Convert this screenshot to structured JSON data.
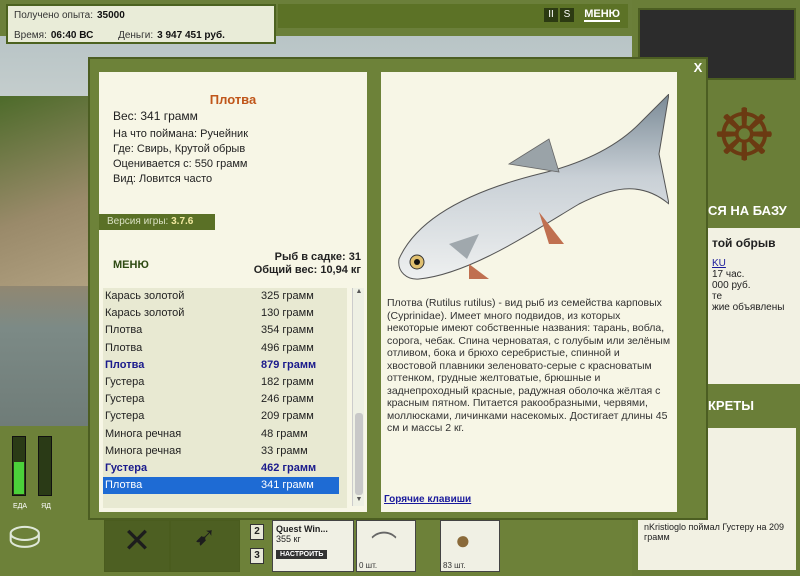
{
  "hud": {
    "experience_label": "Получено опыта:",
    "experience_value": "35000",
    "time_label": "Время:",
    "time_value": "06:40 ВС",
    "money_label": "Деньги:",
    "money_value": "3 947 451 руб."
  },
  "topbar": {
    "pause": "II",
    "sound": "S",
    "menu": "МЕНЮ"
  },
  "modal": {
    "close": "X",
    "fish_name": "Плотва",
    "weight": "Вес: 341 грамм",
    "caught_with": "На что поймана: Ручейник",
    "where": "Где: Свирь, Крутой обрыв",
    "valued_from": "Оценивается с: 550 грамм",
    "kind": "Вид: Ловится часто",
    "version_label": "Версия игры:",
    "version_value": "3.7.6",
    "menu_link": "МЕНЮ",
    "keepnet_count": "Рыб в садке: 31",
    "keepnet_weight": "Общий вес: 10,94 кг",
    "catch_list": [
      {
        "name": "Карась золотой",
        "weight": "325 грамм",
        "style": ""
      },
      {
        "name": "Карась золотой",
        "weight": "130 грамм",
        "style": ""
      },
      {
        "name": "Плотва",
        "weight": "354 грамм",
        "style": ""
      },
      {
        "name": "Плотва",
        "weight": "496 грамм",
        "style": ""
      },
      {
        "name": "Плотва",
        "weight": "879 грамм",
        "style": "bold"
      },
      {
        "name": "Густера",
        "weight": "182 грамм",
        "style": ""
      },
      {
        "name": "Густера",
        "weight": "246 грамм",
        "style": ""
      },
      {
        "name": "Густера",
        "weight": "209 грамм",
        "style": ""
      },
      {
        "name": "Минога речная",
        "weight": "48 грамм",
        "style": ""
      },
      {
        "name": "Минога речная",
        "weight": "33 грамм",
        "style": ""
      },
      {
        "name": "Густера",
        "weight": "462 грамм",
        "style": "bold"
      },
      {
        "name": "Плотва",
        "weight": "341 грамм",
        "style": "sel"
      }
    ],
    "description": "Плотва (Rutilus rutilus) - вид рыб из семейства карповых (Cyprinidae). Имеет много подвидов, из которых некоторые имеют собственные названия: тарань, вобла, сорога, чебак. Спина черноватая, с голубым или зелёным отливом, бока и брюхо серебристые, спинной и хвостовой плавники зеленовато-серые с красноватым оттенком, грудные желтоватые, брюшные и заднепроходный красные, радужная оболочка жёлтая с красным пятном. Питается ракообразными, червями, моллюсками, личинками насекомых. Достигает длины 45 см и массы 2 кг.",
    "hotkeys_link": "Горячие клавиши"
  },
  "right_panel": {
    "base_label": "СЯ НА БАЗУ",
    "location": "той обрыв",
    "lines": [
      "KU",
      "17 час.",
      "000 руб.",
      "те",
      "жие объявлены"
    ],
    "secrets_label": "КРЕТЫ",
    "feed": "nKristioglo поймал Густеру на 209 грамм"
  },
  "bottom": {
    "meter_food_label": "ЕДА",
    "meter_poison_label": "ЯД",
    "meter_food_level": 0.55,
    "meter_poison_level": 0.0,
    "slot2": "2",
    "slot3": "3",
    "quest_title": "Quest Win...",
    "quest_weight": "355 кг",
    "quest_button": "НАСТРОИТЬ",
    "slot_a_count": "0 шт.",
    "slot_b_count": "83 шт."
  }
}
